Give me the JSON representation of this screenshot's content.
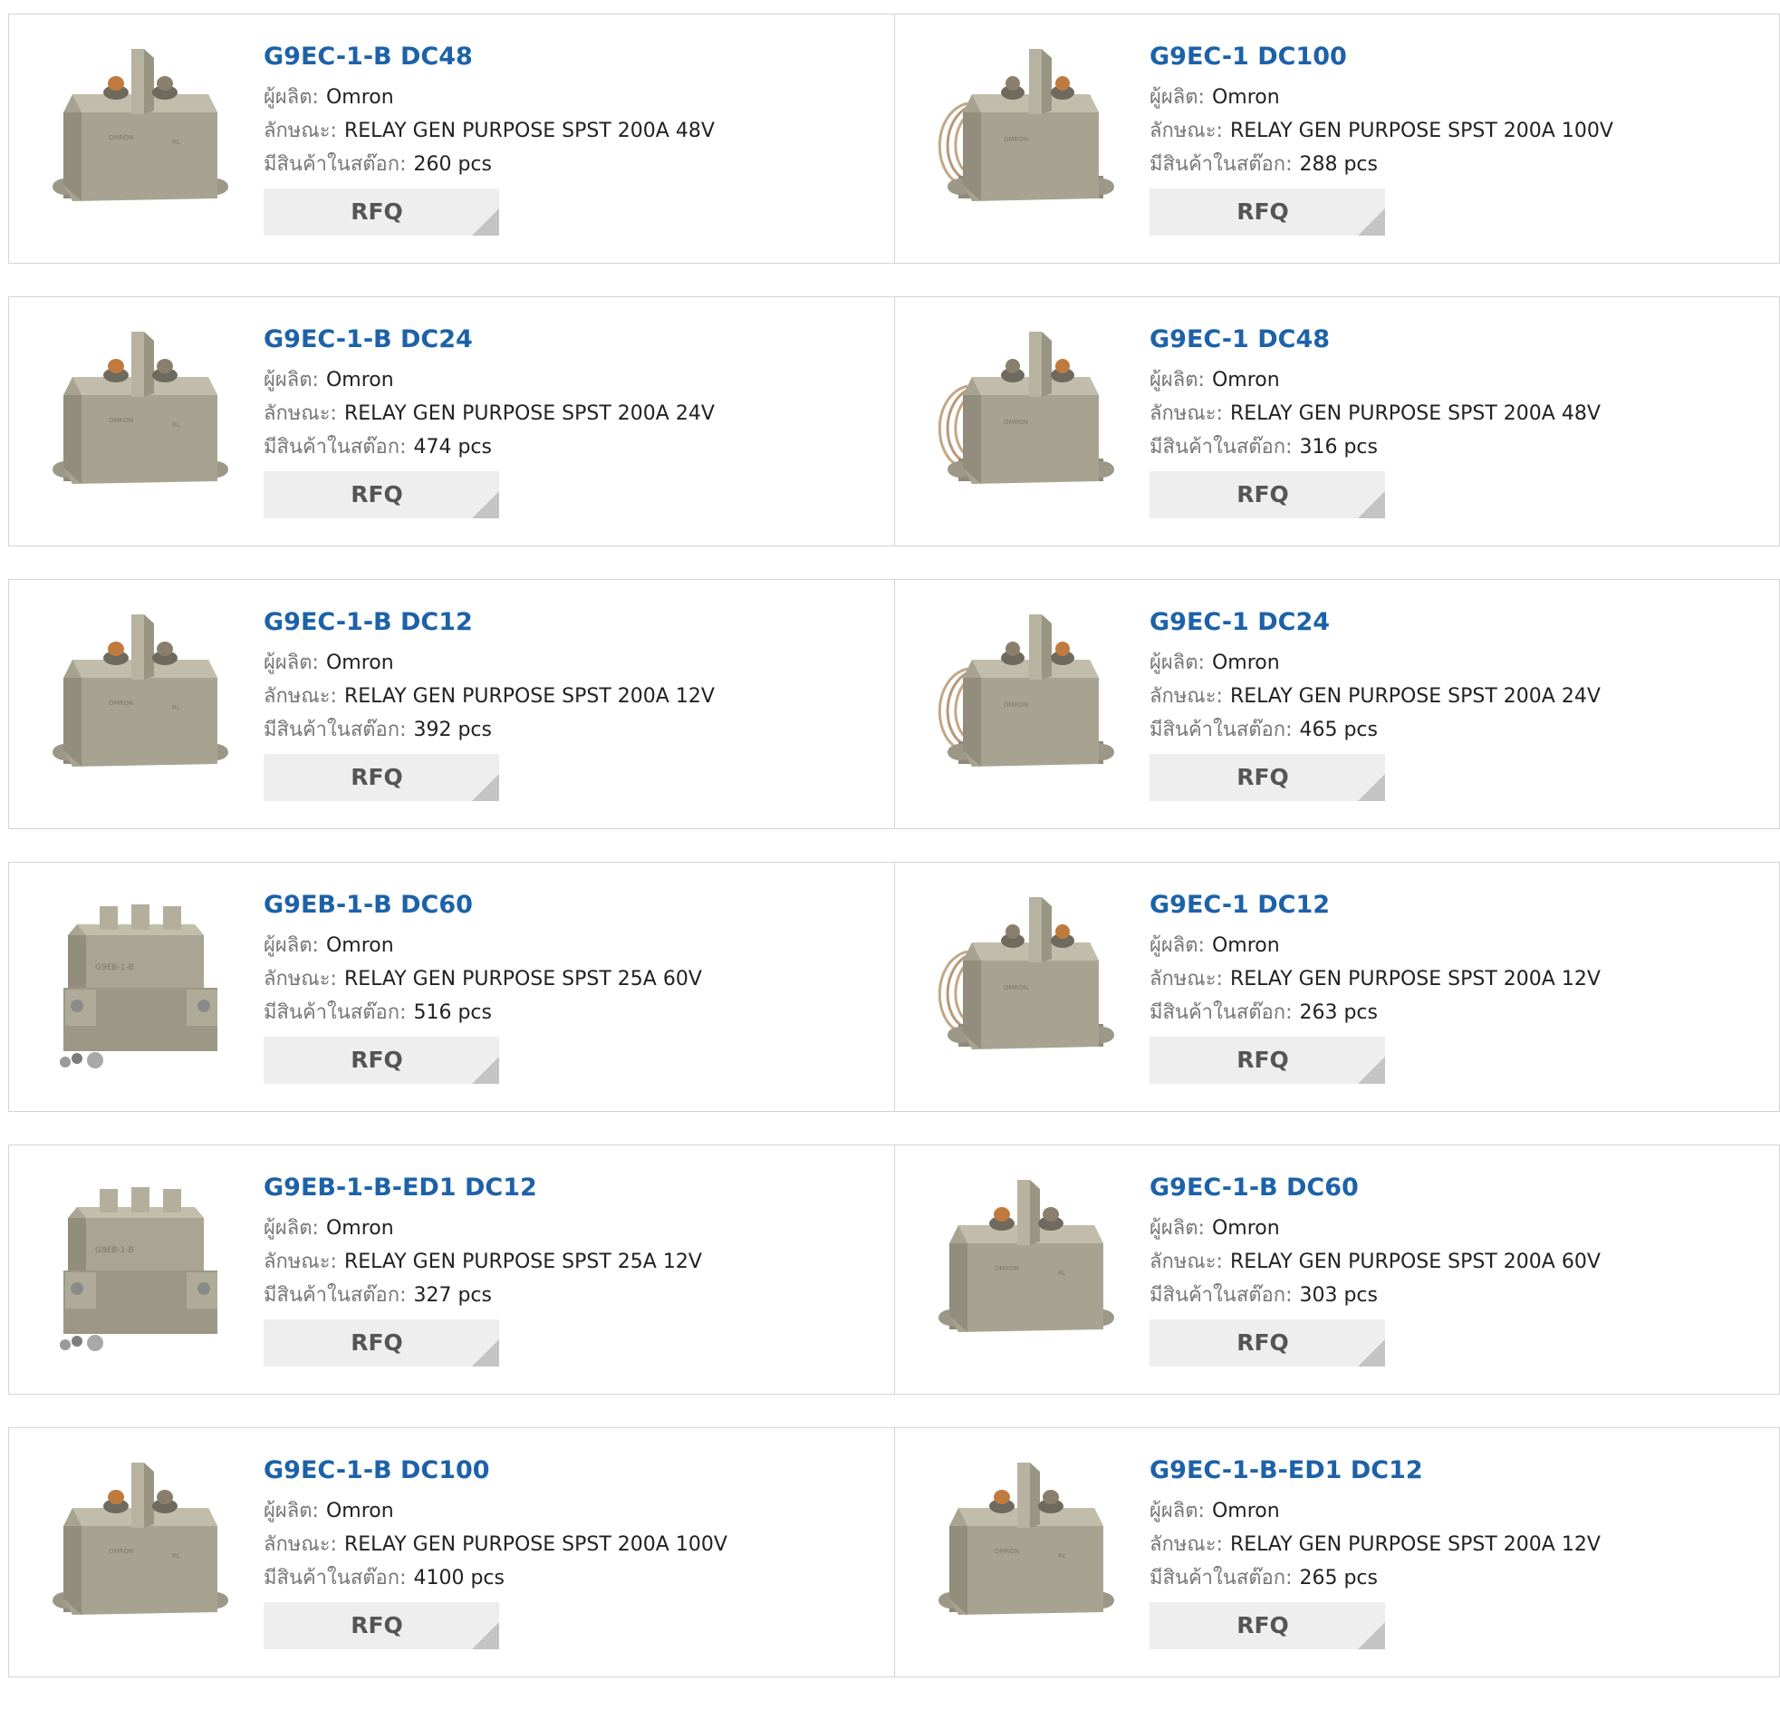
{
  "labels": {
    "manufacturer": "ผู้ผลิต:",
    "description": "ลักษณะ:",
    "stock": "มีสินค้าในสต๊อก:",
    "rfq": "RFQ"
  },
  "colors": {
    "title": "#1d62a8",
    "rfq_bg": "#eeeeee",
    "rfq_corner": "#c4c4c4",
    "border": "#d4d4d4"
  },
  "products": [
    {
      "name": "G9EC-1-B DC48",
      "manufacturer": "Omron",
      "description": "RELAY GEN PURPOSE SPST 200A 48V",
      "stock": "260 pcs",
      "image": "g9ec-b-relay"
    },
    {
      "name": "G9EC-1 DC100",
      "manufacturer": "Omron",
      "description": "RELAY GEN PURPOSE SPST 200A 100V",
      "stock": "288 pcs",
      "image": "g9ec-wired-relay"
    },
    {
      "name": "G9EC-1-B DC24",
      "manufacturer": "Omron",
      "description": "RELAY GEN PURPOSE SPST 200A 24V",
      "stock": "474 pcs",
      "image": "g9ec-b-relay"
    },
    {
      "name": "G9EC-1 DC48",
      "manufacturer": "Omron",
      "description": "RELAY GEN PURPOSE SPST 200A 48V",
      "stock": "316 pcs",
      "image": "g9ec-wired-relay"
    },
    {
      "name": "G9EC-1-B DC12",
      "manufacturer": "Omron",
      "description": "RELAY GEN PURPOSE SPST 200A 12V",
      "stock": "392 pcs",
      "image": "g9ec-b-relay"
    },
    {
      "name": "G9EC-1 DC24",
      "manufacturer": "Omron",
      "description": "RELAY GEN PURPOSE SPST 200A 24V",
      "stock": "465 pcs",
      "image": "g9ec-wired-relay"
    },
    {
      "name": "G9EB-1-B DC60",
      "manufacturer": "Omron",
      "description": "RELAY GEN PURPOSE SPST 25A 60V",
      "stock": "516 pcs",
      "image": "g9eb-relay"
    },
    {
      "name": "G9EC-1 DC12",
      "manufacturer": "Omron",
      "description": "RELAY GEN PURPOSE SPST 200A 12V",
      "stock": "263 pcs",
      "image": "g9ec-wired-relay"
    },
    {
      "name": "G9EB-1-B-ED1 DC12",
      "manufacturer": "Omron",
      "description": "RELAY GEN PURPOSE SPST 25A 12V",
      "stock": "327 pcs",
      "image": "g9eb-relay"
    },
    {
      "name": "G9EC-1-B DC60",
      "manufacturer": "Omron",
      "description": "RELAY GEN PURPOSE SPST 200A 60V",
      "stock": "303 pcs",
      "image": "g9ec-b-relay"
    },
    {
      "name": "G9EC-1-B DC100",
      "manufacturer": "Omron",
      "description": "RELAY GEN PURPOSE SPST 200A 100V",
      "stock": "4100 pcs",
      "image": "g9ec-b-relay"
    },
    {
      "name": "G9EC-1-B-ED1 DC12",
      "manufacturer": "Omron",
      "description": "RELAY GEN PURPOSE SPST 200A 12V",
      "stock": "265 pcs",
      "image": "g9ec-b-relay"
    }
  ]
}
